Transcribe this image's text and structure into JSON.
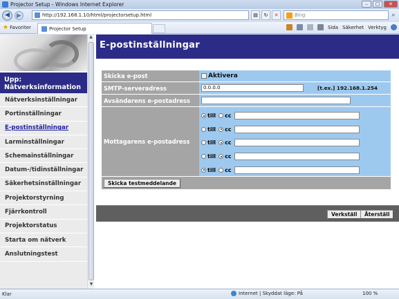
{
  "window": {
    "title": "Projector Setup - Windows Internet Explorer",
    "min": "–",
    "max": "□",
    "close": "✕"
  },
  "address": {
    "url": "http://192.168.1.10/html/projectorsetup.html",
    "search_placeholder": "Bing"
  },
  "favorites": {
    "label": "Favoriter",
    "tab_label": "Projector Setup"
  },
  "commandbar": {
    "page": "Sida",
    "security": "Säkerhet",
    "tools": "Verktyg"
  },
  "sidebar": {
    "header": "Upp: Nätverksinformation",
    "items": [
      {
        "label": "Nätverksinställningar"
      },
      {
        "label": "Portinställningar"
      },
      {
        "label": "E-postinställningar"
      },
      {
        "label": "Larminställningar"
      },
      {
        "label": "Schemainställningar"
      },
      {
        "label": "Datum-/tidinställningar"
      },
      {
        "label": "Säkerhetsinställningar"
      },
      {
        "label": "Projektorstyrning"
      },
      {
        "label": "Fjärrkontroll"
      },
      {
        "label": "Projektorstatus"
      },
      {
        "label": "Starta om nätverk"
      },
      {
        "label": "Anslutningstest"
      }
    ],
    "active_index": 2
  },
  "main": {
    "title": "E-postinställningar",
    "send_email_label": "Skicka e-post",
    "enable_label": "Aktivera",
    "smtp_label": "SMTP-serveradress",
    "smtp_value": "0.0.0.0",
    "smtp_example": "[t.ex.] 192.168.1.254",
    "sender_label": "Avsändarens e-postadress",
    "sender_value": "",
    "recipient_label": "Mottagarens e-postadress",
    "to_label": "till",
    "cc_label": "cc",
    "recipients": [
      {
        "mode": "till",
        "address": ""
      },
      {
        "mode": "cc",
        "address": ""
      },
      {
        "mode": "cc",
        "address": ""
      },
      {
        "mode": "cc",
        "address": ""
      },
      {
        "mode": "till",
        "address": ""
      }
    ],
    "test_button": "Skicka testmeddelande",
    "apply_button": "Verkställ",
    "reset_button": "Återställ"
  },
  "status": {
    "left": "Klar",
    "zone": "Internet | Skyddat läge: På",
    "zoom": "100 %"
  }
}
